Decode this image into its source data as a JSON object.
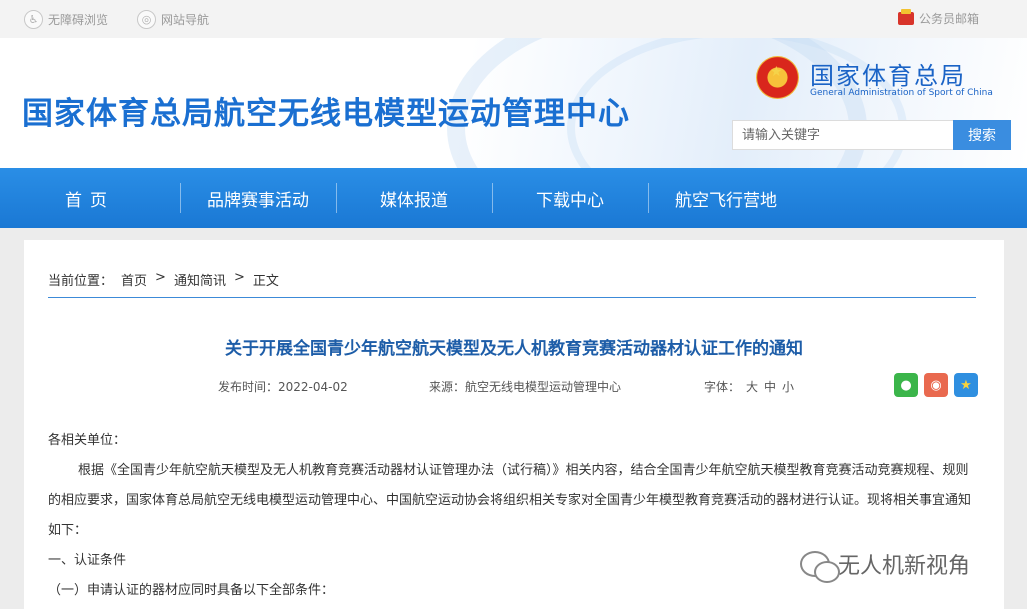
{
  "topbar": {
    "accessibility": "无障碍浏览",
    "site_nav": "网站导航",
    "official_mail": "公务员邮箱"
  },
  "header": {
    "site_title": "国家体育总局航空无线电模型运动管理中心",
    "logo_cn": "国家体育总局",
    "logo_en": "General Administration of Sport of China",
    "search_placeholder": "请输入关键字",
    "search_button": "搜索"
  },
  "nav": {
    "items": [
      {
        "label": "首页"
      },
      {
        "label": "品牌赛事活动"
      },
      {
        "label": "媒体报道"
      },
      {
        "label": "下载中心"
      },
      {
        "label": "航空飞行营地"
      }
    ]
  },
  "breadcrumb": {
    "prefix": "当前位置：",
    "items": [
      "首页",
      "通知简讯",
      "正文"
    ],
    "separator": ">"
  },
  "article": {
    "title": "关于开展全国青少年航空航天模型及无人机教育竞赛活动器材认证工作的通知",
    "publish_date": "发布时间：2022-04-02",
    "source": "来源：航空无线电模型运动管理中心",
    "font_size_label": "字体：",
    "font_sizes": [
      "大",
      "中",
      "小"
    ],
    "salutation": "各相关单位：",
    "paragraph1": "根据《全国青少年航空航天模型及无人机教育竞赛活动器材认证管理办法（试行稿）》相关内容，结合全国青少年航空航天模型教育竞赛活动竞赛规程、规则的相应要求，国家体育总局航空无线电模型运动管理中心、中国航空运动协会将组织相关专家对全国青少年模型教育竞赛活动的器材进行认证。现将相关事宜通知如下：",
    "section1": "一、认证条件",
    "subsection1": "（一）申请认证的器材应同时具备以下全部条件："
  },
  "share_icons": [
    "wechat-icon",
    "weibo-icon",
    "favorite-icon"
  ],
  "watermark": "无人机新视角",
  "colors": {
    "brand_blue": "#1a6fd1",
    "nav_blue": "#1a78d4",
    "title_blue": "#1d5da8",
    "search_btn": "#3a8de0"
  }
}
